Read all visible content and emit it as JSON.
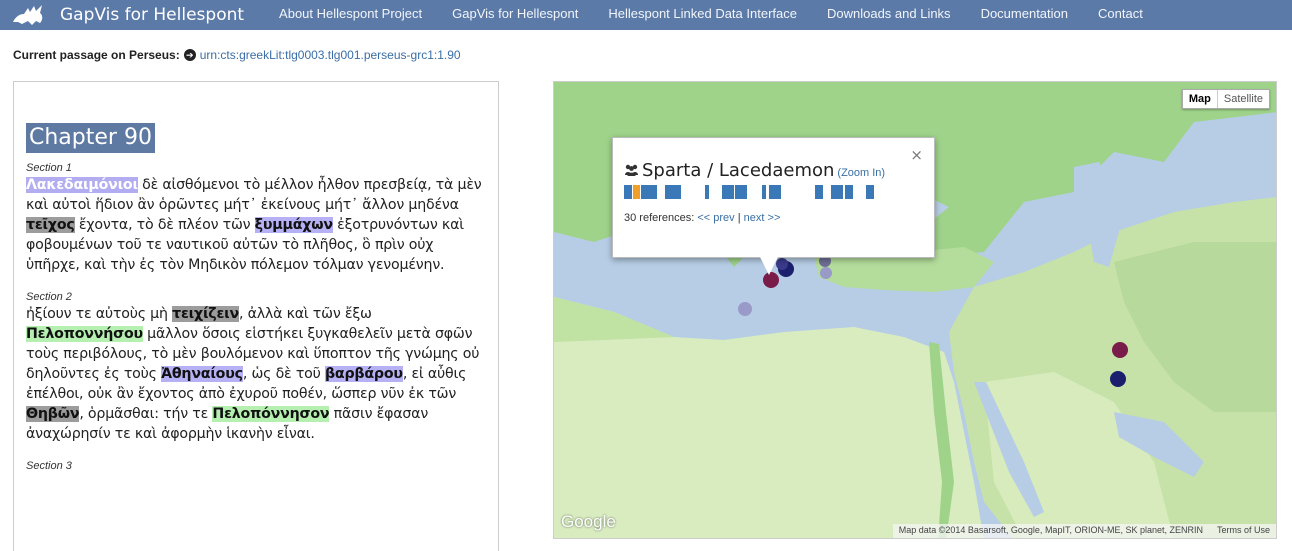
{
  "nav": {
    "brand": "GapVis for Hellespont",
    "items": [
      "About Hellespont Project",
      "GapVis for Hellespont",
      "Hellespont Linked Data Interface",
      "Downloads and Links",
      "Documentation",
      "Contact"
    ]
  },
  "passage": {
    "label": "Current passage on Perseus:",
    "urn": "urn:cts:greekLit:tlg0003.tlg001.perseus-grc1:1.90"
  },
  "text": {
    "chapter": "Chapter 90",
    "section1_label": "Section 1",
    "s1": {
      "w1": "Λακεδαιμόνιοι",
      "t1": " δὲ αἰσθόμενοι τὸ μέλλον ἦλθον πρεσβείᾳ, τὰ μὲν καὶ αὐτοὶ ἥδιον ἂν ὁρῶντες μήτ᾽ ἐκείνους μήτ᾽ ἄλλον μηδένα ",
      "w2": "τεῖχος",
      "t2": " ἔχοντα, τὸ δὲ πλέον τῶν ",
      "w3": "ξυμμάχων",
      "t3": " ἐξοτρυνόντων καὶ φοβουμένων τοῦ τε ναυτικοῦ αὐτῶν τὸ πλῆθος, ὃ πρὶν οὐχ ὑπῆρχε, καὶ τὴν ἐς τὸν Μηδικὸν πόλεμον τόλμαν γενομένην."
    },
    "section2_label": "Section 2",
    "s2": {
      "t0": "ἠξίουν τε αὐτοὺς μὴ ",
      "w1": "τειχίζειν",
      "t1": ", ἀλλὰ καὶ τῶν ἔξω ",
      "w2": "Πελοποννήσου",
      "t2": " μᾶλλον ὅσοις εἱστήκει ξυγκαθελεῖν μετὰ σφῶν τοὺς περιβόλους, τὸ μὲν βουλόμενον καὶ ὕποπτον τῆς γνώμης οὐ δηλοῦντες ἐς τοὺς ",
      "w3": "Ἀθηναίους",
      "t3": ", ὡς δὲ τοῦ ",
      "w4": "βαρβάρου",
      "t4": ", εἰ αὖθις ἐπέλθοι, οὐκ ἂν ἔχοντος ἀπὸ ἐχυροῦ ποθέν, ὥσπερ νῦν ἐκ τῶν ",
      "w5": "Θηβῶν",
      "t5": ", ὁρμᾶσθαι: τήν τε ",
      "w6": "Πελοπόννησον",
      "t6": " πᾶσιν ἔφασαν ἀναχώρησίν τε καὶ ἀφορμὴν ἱκανὴν εἶναι."
    },
    "section3_label": "Section 3"
  },
  "map": {
    "type_map": "Map",
    "type_satellite": "Satellite",
    "popup": {
      "close": "×",
      "place": "Sparta / Lacedaemon",
      "zoom": "(Zoom In)",
      "refs_prefix": "30 references: ",
      "prev": "<< prev",
      "sep": " | ",
      "next": "next >>"
    },
    "google": "Google",
    "attribution": "Map data ©2014 Basarsoft, Google, MapIT, ORION-ME, SK planet, ZENRIN",
    "terms": "Terms of Use",
    "colors": {
      "place_marker": "#7a1c4a",
      "navy_marker": "#1b1f6e",
      "faint_marker": "#9a9ac8",
      "timeline_bar": "#3a78b8",
      "timeline_current": "#f0a028"
    }
  }
}
